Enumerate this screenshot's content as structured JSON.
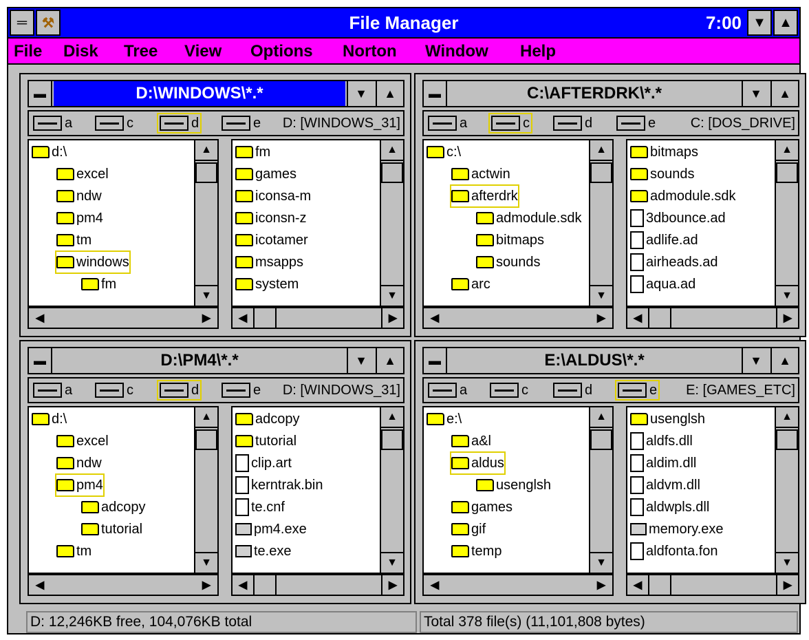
{
  "app": {
    "title": "File Manager",
    "clock": "7:00"
  },
  "menu": [
    "File",
    "Disk",
    "Tree",
    "View",
    "Options",
    "Norton",
    "Window",
    "Help"
  ],
  "windows": [
    {
      "title": "D:\\WINDOWS\\*.*",
      "active": true,
      "drives": [
        "a",
        "c",
        "d",
        "e"
      ],
      "selected_drive": "d",
      "volume": "D: [WINDOWS_31]",
      "tree": [
        {
          "label": "d:\\",
          "depth": 0,
          "open": false,
          "hl": false
        },
        {
          "label": "excel",
          "depth": 1,
          "open": false,
          "hl": false
        },
        {
          "label": "ndw",
          "depth": 1,
          "open": false,
          "hl": false
        },
        {
          "label": "pm4",
          "depth": 1,
          "open": false,
          "hl": false
        },
        {
          "label": "tm",
          "depth": 1,
          "open": false,
          "hl": false
        },
        {
          "label": "windows",
          "depth": 1,
          "open": true,
          "hl": true
        },
        {
          "label": "fm",
          "depth": 2,
          "open": false,
          "hl": false
        }
      ],
      "files": [
        {
          "name": "fm",
          "type": "folder"
        },
        {
          "name": "games",
          "type": "folder"
        },
        {
          "name": "iconsa-m",
          "type": "folder"
        },
        {
          "name": "iconsn-z",
          "type": "folder"
        },
        {
          "name": "icotamer",
          "type": "folder"
        },
        {
          "name": "msapps",
          "type": "folder"
        },
        {
          "name": "system",
          "type": "folder"
        }
      ]
    },
    {
      "title": "C:\\AFTERDRK\\*.*",
      "active": false,
      "drives": [
        "a",
        "c",
        "d",
        "e"
      ],
      "selected_drive": "c",
      "volume": "C: [DOS_DRIVE]",
      "tree": [
        {
          "label": "c:\\",
          "depth": 0,
          "open": false,
          "hl": false
        },
        {
          "label": "actwin",
          "depth": 1,
          "open": false,
          "hl": false
        },
        {
          "label": "afterdrk",
          "depth": 1,
          "open": true,
          "hl": true
        },
        {
          "label": "admodule.sdk",
          "depth": 2,
          "open": false,
          "hl": false
        },
        {
          "label": "bitmaps",
          "depth": 2,
          "open": false,
          "hl": false
        },
        {
          "label": "sounds",
          "depth": 2,
          "open": false,
          "hl": false
        },
        {
          "label": "arc",
          "depth": 1,
          "open": false,
          "hl": false
        }
      ],
      "files": [
        {
          "name": "bitmaps",
          "type": "folder"
        },
        {
          "name": "sounds",
          "type": "folder"
        },
        {
          "name": "admodule.sdk",
          "type": "folder"
        },
        {
          "name": "3dbounce.ad",
          "type": "doc"
        },
        {
          "name": "adlife.ad",
          "type": "doc"
        },
        {
          "name": "airheads.ad",
          "type": "doc"
        },
        {
          "name": "aqua.ad",
          "type": "doc"
        }
      ]
    },
    {
      "title": "D:\\PM4\\*.*",
      "active": false,
      "drives": [
        "a",
        "c",
        "d",
        "e"
      ],
      "selected_drive": "d",
      "volume": "D: [WINDOWS_31]",
      "tree": [
        {
          "label": "d:\\",
          "depth": 0,
          "open": false,
          "hl": false
        },
        {
          "label": "excel",
          "depth": 1,
          "open": false,
          "hl": false
        },
        {
          "label": "ndw",
          "depth": 1,
          "open": false,
          "hl": false
        },
        {
          "label": "pm4",
          "depth": 1,
          "open": true,
          "hl": true
        },
        {
          "label": "adcopy",
          "depth": 2,
          "open": false,
          "hl": false
        },
        {
          "label": "tutorial",
          "depth": 2,
          "open": false,
          "hl": false
        },
        {
          "label": "tm",
          "depth": 1,
          "open": false,
          "hl": false
        }
      ],
      "files": [
        {
          "name": "adcopy",
          "type": "folder"
        },
        {
          "name": "tutorial",
          "type": "folder"
        },
        {
          "name": "clip.art",
          "type": "doc"
        },
        {
          "name": "kerntrak.bin",
          "type": "doc"
        },
        {
          "name": "te.cnf",
          "type": "doc"
        },
        {
          "name": "pm4.exe",
          "type": "exe"
        },
        {
          "name": "te.exe",
          "type": "exe"
        }
      ]
    },
    {
      "title": "E:\\ALDUS\\*.*",
      "active": false,
      "drives": [
        "a",
        "c",
        "d",
        "e"
      ],
      "selected_drive": "e",
      "volume": "E: [GAMES_ETC]",
      "tree": [
        {
          "label": "e:\\",
          "depth": 0,
          "open": false,
          "hl": false
        },
        {
          "label": "a&l",
          "depth": 1,
          "open": false,
          "hl": false
        },
        {
          "label": "aldus",
          "depth": 1,
          "open": true,
          "hl": true
        },
        {
          "label": "usenglsh",
          "depth": 2,
          "open": false,
          "hl": false
        },
        {
          "label": "games",
          "depth": 1,
          "open": false,
          "hl": false
        },
        {
          "label": "gif",
          "depth": 1,
          "open": false,
          "hl": false
        },
        {
          "label": "temp",
          "depth": 1,
          "open": false,
          "hl": false
        }
      ],
      "files": [
        {
          "name": "usenglsh",
          "type": "folder"
        },
        {
          "name": "aldfs.dll",
          "type": "doc"
        },
        {
          "name": "aldim.dll",
          "type": "doc"
        },
        {
          "name": "aldvm.dll",
          "type": "doc"
        },
        {
          "name": "aldwpls.dll",
          "type": "doc"
        },
        {
          "name": "memory.exe",
          "type": "exe"
        },
        {
          "name": "aldfonta.fon",
          "type": "doc"
        }
      ]
    }
  ],
  "status": {
    "left": "D: 12,246KB free,  104,076KB total",
    "right": "Total 378 file(s) (11,101,808 bytes)"
  }
}
